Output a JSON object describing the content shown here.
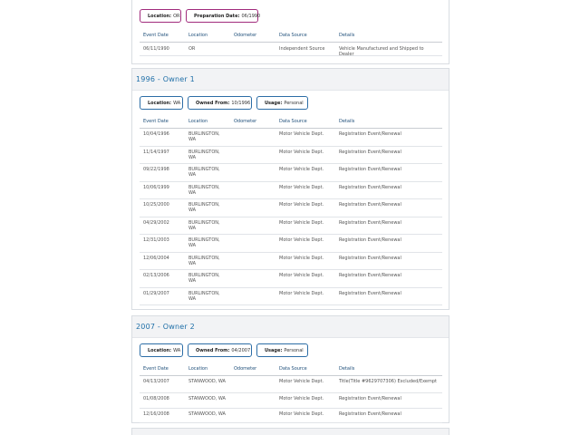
{
  "sections": [
    {
      "title": "",
      "chips": [
        {
          "label": "Location:",
          "value": "OR"
        },
        {
          "label": "Preparation Date:",
          "value": "06/1990"
        }
      ],
      "headers": [
        "Event Date",
        "Location",
        "Odometer",
        "Data Source",
        "Details"
      ],
      "rows": [
        {
          "date": "06/11/1990",
          "location": "OR",
          "odometer": "",
          "source": "Independent Source",
          "details": "Vehicle Manufactured and Shipped to Dealer"
        }
      ]
    },
    {
      "title": "1996 - Owner   1",
      "chips": [
        {
          "label": "Location:",
          "value": "WA"
        },
        {
          "label": "Owned From:",
          "value": "10/1996"
        },
        {
          "label": "Usage:",
          "value": "Personal"
        }
      ],
      "headers": [
        "Event Date",
        "Location",
        "Odometer",
        "Data Source",
        "Details"
      ],
      "rows": [
        {
          "date": "10/04/1996",
          "location": "BURLINGTON, WA",
          "odometer": "",
          "source": "Motor Vehicle Dept.",
          "details": "Registration Event/Renewal"
        },
        {
          "date": "11/14/1997",
          "location": "BURLINGTON, WA",
          "odometer": "",
          "source": "Motor Vehicle Dept.",
          "details": "Registration Event/Renewal"
        },
        {
          "date": "09/22/1998",
          "location": "BURLINGTON, WA",
          "odometer": "",
          "source": "Motor Vehicle Dept.",
          "details": "Registration Event/Renewal"
        },
        {
          "date": "10/06/1999",
          "location": "BURLINGTON, WA",
          "odometer": "",
          "source": "Motor Vehicle Dept.",
          "details": "Registration Event/Renewal"
        },
        {
          "date": "10/25/2000",
          "location": "BURLINGTON, WA",
          "odometer": "",
          "source": "Motor Vehicle Dept.",
          "details": "Registration Event/Renewal"
        },
        {
          "date": "04/29/2002",
          "location": "BURLINGTON, WA",
          "odometer": "",
          "source": "Motor Vehicle Dept.",
          "details": "Registration Event/Renewal"
        },
        {
          "date": "12/31/2003",
          "location": "BURLINGTON, WA",
          "odometer": "",
          "source": "Motor Vehicle Dept.",
          "details": "Registration Event/Renewal"
        },
        {
          "date": "12/06/2004",
          "location": "BURLINGTON, WA",
          "odometer": "",
          "source": "Motor Vehicle Dept.",
          "details": "Registration Event/Renewal"
        },
        {
          "date": "02/13/2006",
          "location": "BURLINGTON, WA",
          "odometer": "",
          "source": "Motor Vehicle Dept.",
          "details": "Registration Event/Renewal"
        },
        {
          "date": "01/29/2007",
          "location": "BURLINGTON, WA",
          "odometer": "",
          "source": "Motor Vehicle Dept.",
          "details": "Registration Event/Renewal"
        }
      ]
    },
    {
      "title": "2007 - Owner   2",
      "chips": [
        {
          "label": "Location:",
          "value": "WA"
        },
        {
          "label": "Owned From:",
          "value": "04/2007"
        },
        {
          "label": "Usage:",
          "value": "Personal"
        }
      ],
      "headers": [
        "Event Date",
        "Location",
        "Odometer",
        "Data Source",
        "Details"
      ],
      "rows": [
        {
          "date": "04/13/2007",
          "location": "STANWOOD, WA",
          "odometer": "",
          "source": "Motor Vehicle Dept.",
          "details": "Title(Title #9629707306) Excluded/Exempt"
        },
        {
          "date": "01/08/2008",
          "location": "STANWOOD, WA",
          "odometer": "",
          "source": "Motor Vehicle Dept.",
          "details": "Registration Event/Renewal"
        },
        {
          "date": "12/16/2008",
          "location": "STANWOOD, WA",
          "odometer": "",
          "source": "Motor Vehicle Dept.",
          "details": "Registration Event/Renewal"
        }
      ]
    }
  ]
}
